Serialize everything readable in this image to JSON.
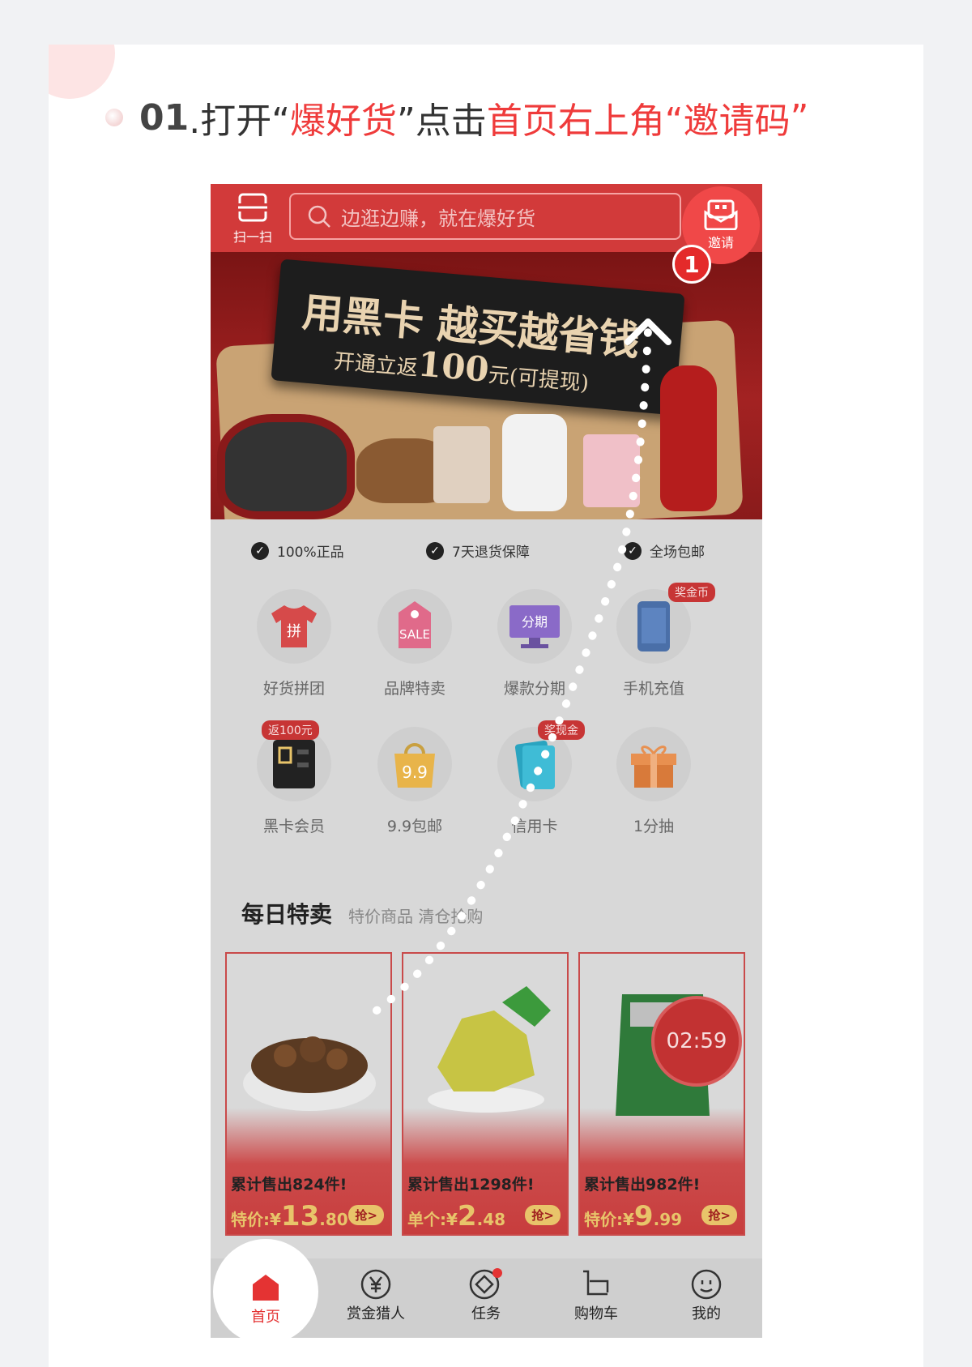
{
  "step": {
    "number": "01",
    "text_parts": [
      ".打开“",
      "爆好货",
      "”点击",
      "首页右上角“邀请码",
      "”"
    ]
  },
  "app": {
    "scan_label": "扫一扫",
    "search_placeholder": "边逛边赚，就在爆好货",
    "invite_label": "邀请",
    "callout_number": "1"
  },
  "banner": {
    "headline": "用黑卡 越买越省钱",
    "sub_prefix": "开通立返",
    "sub_amount": "100",
    "sub_suffix": "元(可提现)"
  },
  "guarantees": [
    "100%正品",
    "7天退货保障",
    "全场包邮"
  ],
  "categories": [
    {
      "label": "好货拼团",
      "icon": "shirt-icon",
      "badge": ""
    },
    {
      "label": "品牌特卖",
      "icon": "sale-tag-icon",
      "badge": ""
    },
    {
      "label": "爆款分期",
      "icon": "monitor-icon",
      "badge": ""
    },
    {
      "label": "手机充值",
      "icon": "phone-icon",
      "badge": "奖金币"
    },
    {
      "label": "黑卡会员",
      "icon": "black-card-icon",
      "badge": "返100元"
    },
    {
      "label": "9.9包邮",
      "icon": "bag-icon",
      "badge": ""
    },
    {
      "label": "信用卡",
      "icon": "credit-card-icon",
      "badge": "奖现金"
    },
    {
      "label": "1分抽",
      "icon": "gift-icon",
      "badge": ""
    }
  ],
  "daily": {
    "title": "每日特卖",
    "subtitle": "特价商品 清仓抢购"
  },
  "products": [
    {
      "sold": "累计售出824件!",
      "price_label": "特价:¥",
      "price_main": "13",
      "price_dec": ".80",
      "buy": "抢>"
    },
    {
      "sold": "累计售出1298件!",
      "price_label": "单个:¥",
      "price_main": "2",
      "price_dec": ".48",
      "buy": "抢>"
    },
    {
      "sold": "累计售出982件!",
      "price_label": "特价:¥",
      "price_main": "9",
      "price_dec": ".99",
      "buy": "抢>"
    }
  ],
  "timer": "02:59",
  "tabs": [
    "首页",
    "赏金猎人",
    "任务",
    "购物车",
    "我的"
  ],
  "colors": {
    "brand_red": "#ef3b3b",
    "app_red": "#d23a3a"
  }
}
